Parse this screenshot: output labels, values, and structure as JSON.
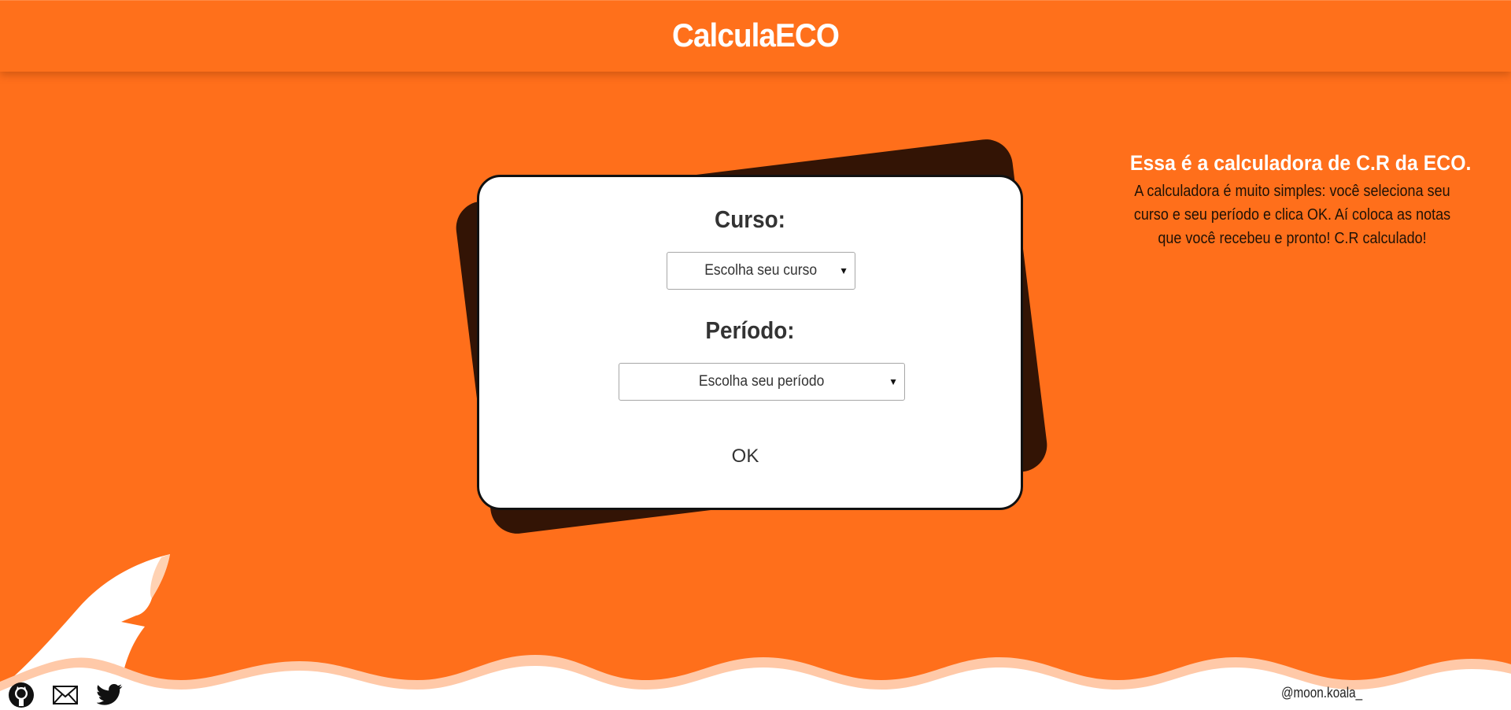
{
  "header": {
    "title": "CalculaECO"
  },
  "form": {
    "course_label": "Curso:",
    "course_select_value": "Escolha seu curso",
    "period_label": "Período:",
    "period_select_value": "Escolha seu período",
    "ok_label": "OK"
  },
  "info": {
    "title": "Essa é a calculadora de C.R da ECO.",
    "paragraph": "A calculadora é muito simples: você seleciona seu curso e seu período e clica OK. Aí coloca as notas que você recebeu e pronto! C.R calculado!"
  },
  "footer": {
    "handle": "@moon.koala_",
    "icons": [
      "github-icon",
      "mail-icon",
      "twitter-icon"
    ]
  },
  "colors": {
    "background": "#ff6f1b",
    "card_shadow": "#331405",
    "card": "#ffffff",
    "wave": "#ffffff"
  }
}
